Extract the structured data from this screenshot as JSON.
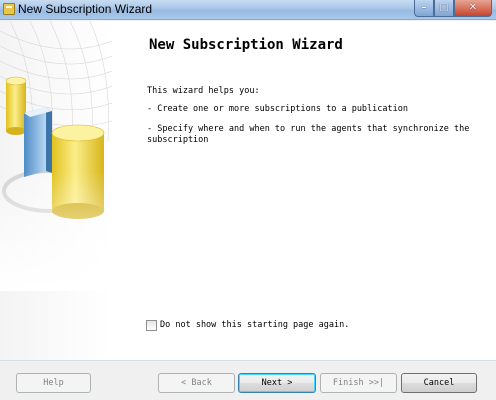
{
  "window": {
    "title": "New Subscription Wizard",
    "controls": {
      "minimize": "–",
      "maximize": "□",
      "close": "✕"
    }
  },
  "page": {
    "heading": "New Subscription Wizard",
    "intro": "This wizard helps you:",
    "bullets": [
      "- Create one or more subscriptions to a publication",
      "- Specify where and when to run the agents that synchronize the subscription"
    ],
    "checkbox": {
      "label": "Do not show this starting page again.",
      "checked": false
    }
  },
  "buttons": {
    "help": "Help",
    "back": "< Back",
    "next": "Next >",
    "finish": "Finish >>|",
    "cancel": "Cancel"
  },
  "colors": {
    "titlebar": "#a9c6e8",
    "close_button": "#c7452c",
    "cylinder_yellow": "#f1d53a",
    "book_blue": "#6aa3d6"
  }
}
